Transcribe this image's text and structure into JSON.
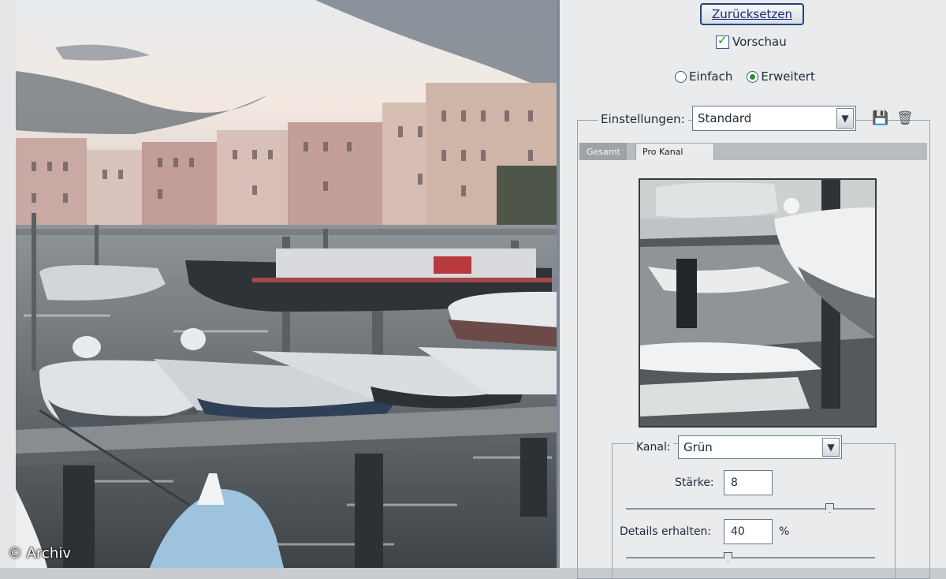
{
  "preview": {
    "copyright": "© Archiv"
  },
  "dialog": {
    "reset_button": "Zurücksetzen",
    "preview_checkbox": {
      "label": "Vorschau",
      "checked": true
    },
    "mode": {
      "options": [
        {
          "label": "Einfach",
          "selected": false
        },
        {
          "label": "Erweitert",
          "selected": true
        }
      ]
    },
    "settings": {
      "label": "Einstellungen:",
      "value": "Standard"
    },
    "setting_icons": [
      "save-settings-icon",
      "delete-settings-icon"
    ],
    "tabs": [
      {
        "label": "Gesamt",
        "active": false
      },
      {
        "label": "Pro Kanal",
        "active": true
      }
    ],
    "channel": {
      "label": "Kanal:",
      "value": "Grün",
      "strength": {
        "label": "Stärke:",
        "value": "8",
        "slider_fraction": 0.8
      },
      "details": {
        "label": "Details erhalten:",
        "value": "40",
        "unit": "%",
        "slider_fraction": 0.4
      }
    }
  },
  "colors": {
    "accent_button_border": "#25437d",
    "checkbox_mark": "#2f8a2f",
    "panel_bg": "#e9ebec"
  }
}
